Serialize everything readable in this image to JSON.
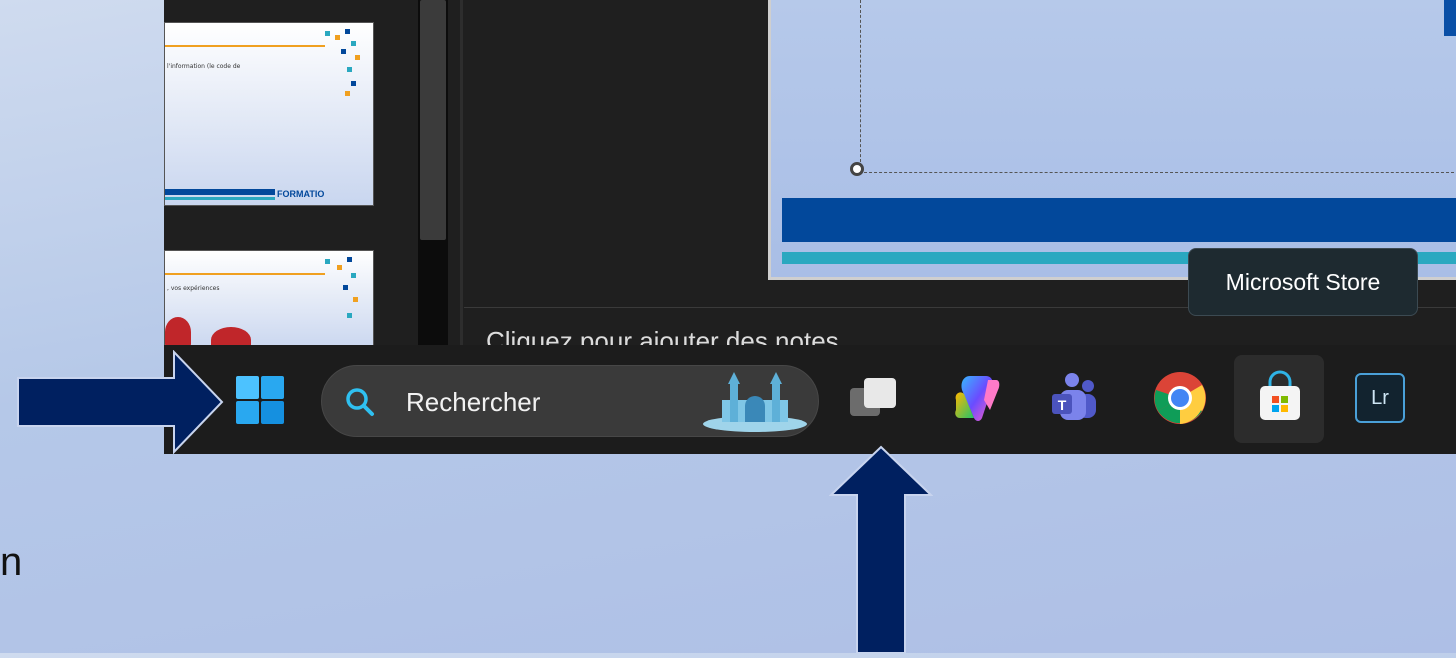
{
  "slides": [
    {
      "text": "l'information (le code de"
    },
    {
      "text": ", vos expériences"
    }
  ],
  "slide_footer_brand": "FORMATIO",
  "notes_placeholder": "Cliquez pour ajouter des notes",
  "tooltip": "Microsoft Store",
  "taskbar": {
    "search_placeholder": "Rechercher",
    "apps": [
      {
        "name": "Task View"
      },
      {
        "name": "Copilot"
      },
      {
        "name": "Microsoft Teams"
      },
      {
        "name": "Google Chrome"
      },
      {
        "name": "Microsoft Store"
      },
      {
        "name": "Adobe Lightroom",
        "label": "Lr"
      }
    ]
  },
  "partial_text": "n",
  "colors": {
    "slide_blue": "#02489b",
    "slide_teal": "#2aa8c0",
    "arrow": "#002060",
    "taskbar_bg": "#1c1c1c"
  },
  "icons": [
    "windows-start-icon",
    "search-icon",
    "task-view-icon",
    "copilot-icon",
    "teams-icon",
    "chrome-icon",
    "store-icon",
    "lightroom-icon",
    "arrow-right-icon",
    "arrow-up-icon"
  ]
}
